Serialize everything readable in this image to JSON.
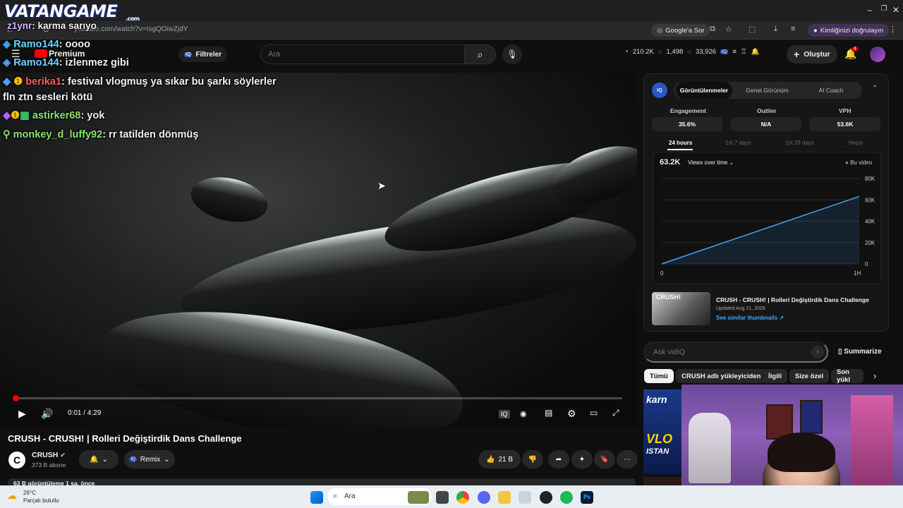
{
  "overlay_brand": {
    "name": "VATANGAME",
    "suffix": ".com"
  },
  "browser": {
    "url": "youtube.com/watch?v=IsgQOiwZjdY",
    "google_ask": "Google'a Sor",
    "verify": "Kimliğinizi doğrulayın"
  },
  "youtube": {
    "premium_label": "Premium",
    "filters_label": "Filtreler",
    "search_placeholder": "Ara",
    "stats": {
      "views": "210.2K",
      "comments": "1,498",
      "likes": "33,926"
    },
    "create_label": "Oluştur",
    "notif_count": "4"
  },
  "chat_overlay": [
    {
      "user": "z1ynr",
      "msg": ": karma sarıyo",
      "color": "#d7b3ff"
    },
    {
      "user": "Ramo144",
      "msg": ": oooo",
      "color": "#6fd3ff"
    },
    {
      "user": "Ramo144",
      "msg": ": izlenmez gibi",
      "color": "#6fd3ff"
    },
    {
      "user": "berika1",
      "msg": ": festival vlogmuş ya sıkar bu şarkı söylerler",
      "color": "#ff5a5a"
    },
    {
      "user": "",
      "msg": "fln ztn sesleri kötü",
      "color": "#ffffff"
    },
    {
      "user": "astirker68",
      "msg": ": yok",
      "color": "#8de36b"
    },
    {
      "user": "monkey_d_luffy92",
      "msg": ": rr tatilden dönmüş",
      "color": "#8de36b"
    }
  ],
  "player": {
    "time": "0:01 / 4:29",
    "progress": 0.004
  },
  "video": {
    "title": "CRUSH - CRUSH! | Rolleri Değiştirdik Dans Challenge",
    "channel": "CRUSH",
    "subs": "373 B abone",
    "remix": "Remix",
    "likes": "21 B",
    "views_line": "63 B görüntüleme  1 sa. önce"
  },
  "vidiq": {
    "tabs": [
      "Görüntülenmeler",
      "Genel Görünüm",
      "AI Coach"
    ],
    "metrics": [
      {
        "label": "Engagement",
        "value": "35.6%"
      },
      {
        "label": "Outlier",
        "value": "N/A"
      },
      {
        "label": "VPH",
        "value": "53.6K"
      }
    ],
    "ranges": [
      "24 hours",
      "1st 7 days",
      "1st 28 days",
      "Hepsi"
    ],
    "total": "63.2K",
    "metric_select": "Views over time",
    "legend": "Bu video",
    "card_title": "CRUSH - CRUSH! | Rolleri Değiştirdik Dans Challenge",
    "card_updated": "Updated Aug 21, 2026",
    "card_link": "See similar thumbnails ↗",
    "ask_placeholder": "Ask vidIQ",
    "summarize": "Summarize"
  },
  "chart_data": {
    "type": "line",
    "x": [
      "0",
      "1H"
    ],
    "yticks": [
      "80K",
      "60K",
      "40K",
      "20K",
      "0"
    ],
    "ylim": [
      0,
      80000
    ],
    "series": [
      {
        "name": "Bu video",
        "values": [
          0,
          63200
        ]
      }
    ]
  },
  "chips": [
    "Tümü",
    "CRUSH adlı yükleyiciden",
    "İlgili",
    "Size özel",
    "Son yükl"
  ],
  "rec_thumb_text": {
    "top": "karn",
    "bottom": "VLO",
    "sub": "ISTAN"
  },
  "taskbar": {
    "temp": "26°C",
    "weather": "Parçalı bulutlu",
    "search": "Ara"
  },
  "colors": {
    "accent": "#3ea6ff",
    "red": "#ff0000",
    "vidiq_blue": "#2b59c3"
  }
}
